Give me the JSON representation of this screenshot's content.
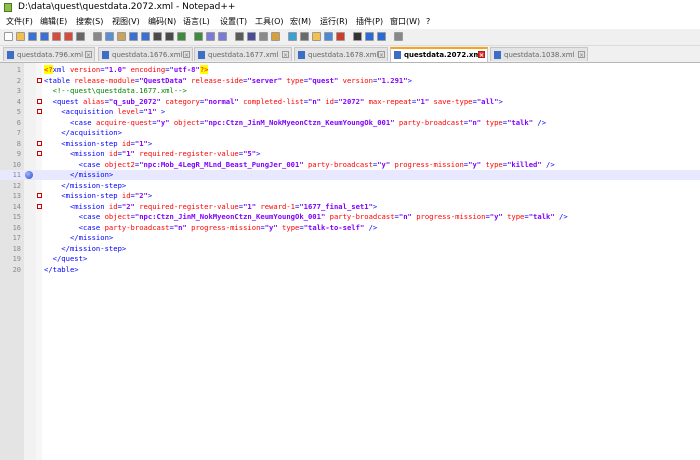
{
  "window": {
    "title": "D:\\data\\quest\\questdata.2072.xml - Notepad++"
  },
  "menu": [
    "文件(F)",
    "编辑(E)",
    "搜索(S)",
    "视图(V)",
    "编码(N)",
    "语言(L)",
    "设置(T)",
    "工具(O)",
    "宏(M)",
    "运行(R)",
    "插件(P)",
    "窗口(W)",
    "?"
  ],
  "tabs": [
    {
      "label": "questdata.796.xml",
      "active": false
    },
    {
      "label": "questdata.1676.xml",
      "active": false
    },
    {
      "label": "questdata.1677.xml",
      "active": false
    },
    {
      "label": "questdata.1678.xml",
      "active": false
    },
    {
      "label": "questdata.2072.xml",
      "active": true
    },
    {
      "label": "questdata.1038.xml",
      "active": false
    }
  ],
  "toolbar_icons": [
    "new-file-icon",
    "open-file-icon",
    "save-icon",
    "save-all-icon",
    "close-icon",
    "close-all-icon",
    "print-icon",
    "cut-icon",
    "copy-icon",
    "paste-icon",
    "undo-icon",
    "redo-icon",
    "find-icon",
    "replace-icon",
    "zoom-in-icon",
    "zoom-out-icon",
    "sync-v-icon",
    "sync-h-icon",
    "word-wrap-icon",
    "show-all-chars-icon",
    "indent-guide-icon",
    "lang-icon",
    "doc-map-icon",
    "func-list-icon",
    "folder-icon",
    "monitor-icon",
    "record-macro-icon",
    "stop-macro-icon",
    "play-macro-icon",
    "play-multi-icon",
    "save-macro-icon"
  ],
  "editor": {
    "current_line": 11,
    "bookmark_line": 11,
    "lines": [
      [
        [
          "decl",
          "<?"
        ],
        [
          "tag",
          "xml "
        ],
        [
          "attr",
          "version"
        ],
        [
          "tag",
          "="
        ],
        [
          "val",
          "\"1.0\""
        ],
        [
          "tag",
          " "
        ],
        [
          "attr",
          "encoding"
        ],
        [
          "tag",
          "="
        ],
        [
          "val",
          "\"utf-8\""
        ],
        [
          "decl",
          "?>"
        ]
      ],
      [
        [
          "tag",
          "<table "
        ],
        [
          "attr",
          "release-module"
        ],
        [
          "tag",
          "="
        ],
        [
          "val",
          "\"QuestData\""
        ],
        [
          "tag",
          " "
        ],
        [
          "attr",
          "release-side"
        ],
        [
          "tag",
          "="
        ],
        [
          "val",
          "\"server\""
        ],
        [
          "tag",
          " "
        ],
        [
          "attr",
          "type"
        ],
        [
          "tag",
          "="
        ],
        [
          "val",
          "\"quest\""
        ],
        [
          "tag",
          " "
        ],
        [
          "attr",
          "version"
        ],
        [
          "tag",
          "="
        ],
        [
          "val",
          "\"1.291\""
        ],
        [
          "tag",
          ">"
        ]
      ],
      [
        [
          "com",
          "  <!--quest\\questdata.1677.xml-->"
        ]
      ],
      [
        [
          "tag",
          "  <quest "
        ],
        [
          "attr",
          "alias"
        ],
        [
          "tag",
          "="
        ],
        [
          "val",
          "\"q_sub_2072\""
        ],
        [
          "tag",
          " "
        ],
        [
          "attr",
          "category"
        ],
        [
          "tag",
          "="
        ],
        [
          "val",
          "\"normal\""
        ],
        [
          "tag",
          " "
        ],
        [
          "attr",
          "completed-list"
        ],
        [
          "tag",
          "="
        ],
        [
          "val",
          "\"n\""
        ],
        [
          "tag",
          " "
        ],
        [
          "attr",
          "id"
        ],
        [
          "tag",
          "="
        ],
        [
          "val",
          "\"2072\""
        ],
        [
          "tag",
          " "
        ],
        [
          "attr",
          "max-repeat"
        ],
        [
          "tag",
          "="
        ],
        [
          "val",
          "\"1\""
        ],
        [
          "tag",
          " "
        ],
        [
          "attr",
          "save-type"
        ],
        [
          "tag",
          "="
        ],
        [
          "val",
          "\"all\""
        ],
        [
          "tag",
          ">"
        ]
      ],
      [
        [
          "tag",
          "    <acquisition "
        ],
        [
          "attr",
          "level"
        ],
        [
          "tag",
          "="
        ],
        [
          "val",
          "\"1\""
        ],
        [
          "tag",
          " >"
        ]
      ],
      [
        [
          "tag",
          "      <case "
        ],
        [
          "attr",
          "acquire-quest"
        ],
        [
          "tag",
          "="
        ],
        [
          "val",
          "\"y\""
        ],
        [
          "tag",
          " "
        ],
        [
          "attr",
          "object"
        ],
        [
          "tag",
          "="
        ],
        [
          "val",
          "\"npc:Ctzn_JinM_NokMyeonCtzn_KeumYoungOk_001\""
        ],
        [
          "tag",
          " "
        ],
        [
          "attr",
          "party-broadcast"
        ],
        [
          "tag",
          "="
        ],
        [
          "val",
          "\"n\""
        ],
        [
          "tag",
          " "
        ],
        [
          "attr",
          "type"
        ],
        [
          "tag",
          "="
        ],
        [
          "val",
          "\"talk\""
        ],
        [
          "tag",
          " />"
        ]
      ],
      [
        [
          "tag",
          "    </acquisition>"
        ]
      ],
      [
        [
          "tag",
          "    <mission-step "
        ],
        [
          "attr",
          "id"
        ],
        [
          "tag",
          "="
        ],
        [
          "val",
          "\"1\""
        ],
        [
          "tag",
          ">"
        ]
      ],
      [
        [
          "tag",
          "      <mission "
        ],
        [
          "attr",
          "id"
        ],
        [
          "tag",
          "="
        ],
        [
          "val",
          "\"1\""
        ],
        [
          "tag",
          " "
        ],
        [
          "attr",
          "required-register-value"
        ],
        [
          "tag",
          "="
        ],
        [
          "val",
          "\"5\""
        ],
        [
          "tag",
          ">"
        ]
      ],
      [
        [
          "tag",
          "        <case "
        ],
        [
          "attr",
          "object2"
        ],
        [
          "tag",
          "="
        ],
        [
          "val",
          "\"npc:Mob_4LegR_MLnd_Beast_PungJer_001\""
        ],
        [
          "tag",
          " "
        ],
        [
          "attr",
          "party-broadcast"
        ],
        [
          "tag",
          "="
        ],
        [
          "val",
          "\"y\""
        ],
        [
          "tag",
          " "
        ],
        [
          "attr",
          "progress-mission"
        ],
        [
          "tag",
          "="
        ],
        [
          "val",
          "\"y\""
        ],
        [
          "tag",
          " "
        ],
        [
          "attr",
          "type"
        ],
        [
          "tag",
          "="
        ],
        [
          "val",
          "\"killed\""
        ],
        [
          "tag",
          " />"
        ]
      ],
      [
        [
          "tag",
          "      </mission>"
        ]
      ],
      [
        [
          "tag",
          "    </mission-step>"
        ]
      ],
      [
        [
          "tag",
          "    <mission-step "
        ],
        [
          "attr",
          "id"
        ],
        [
          "tag",
          "="
        ],
        [
          "val",
          "\"2\""
        ],
        [
          "tag",
          ">"
        ]
      ],
      [
        [
          "tag",
          "      <mission "
        ],
        [
          "attr",
          "id"
        ],
        [
          "tag",
          "="
        ],
        [
          "val",
          "\"2\""
        ],
        [
          "tag",
          " "
        ],
        [
          "attr",
          "required-register-value"
        ],
        [
          "tag",
          "="
        ],
        [
          "val",
          "\"1\""
        ],
        [
          "tag",
          " "
        ],
        [
          "attr",
          "reward-1"
        ],
        [
          "tag",
          "="
        ],
        [
          "val",
          "\"1677_final_set1\""
        ],
        [
          "tag",
          ">"
        ]
      ],
      [
        [
          "tag",
          "        <case "
        ],
        [
          "attr",
          "object"
        ],
        [
          "tag",
          "="
        ],
        [
          "val",
          "\"npc:Ctzn_JinM_NokMyeonCtzn_KeumYoungOk_001\""
        ],
        [
          "tag",
          " "
        ],
        [
          "attr",
          "party-broadcast"
        ],
        [
          "tag",
          "="
        ],
        [
          "val",
          "\"n\""
        ],
        [
          "tag",
          " "
        ],
        [
          "attr",
          "progress-mission"
        ],
        [
          "tag",
          "="
        ],
        [
          "val",
          "\"y\""
        ],
        [
          "tag",
          " "
        ],
        [
          "attr",
          "type"
        ],
        [
          "tag",
          "="
        ],
        [
          "val",
          "\"talk\""
        ],
        [
          "tag",
          " />"
        ]
      ],
      [
        [
          "tag",
          "        <case "
        ],
        [
          "attr",
          "party-broadcast"
        ],
        [
          "tag",
          "="
        ],
        [
          "val",
          "\"n\""
        ],
        [
          "tag",
          " "
        ],
        [
          "attr",
          "progress-mission"
        ],
        [
          "tag",
          "="
        ],
        [
          "val",
          "\"y\""
        ],
        [
          "tag",
          " "
        ],
        [
          "attr",
          "type"
        ],
        [
          "tag",
          "="
        ],
        [
          "val",
          "\"talk-to-self\""
        ],
        [
          "tag",
          " />"
        ]
      ],
      [
        [
          "tag",
          "      </mission>"
        ]
      ],
      [
        [
          "tag",
          "    </mission-step>"
        ]
      ],
      [
        [
          "tag",
          "  </quest>"
        ]
      ],
      [
        [
          "tag",
          "</table>"
        ]
      ]
    ]
  },
  "colors": {
    "tag": "#0000ff",
    "attr": "#ff0000",
    "val": "#8000ff",
    "comment": "#008000",
    "active_tab_accent": "#f7a31c",
    "current_line": "#e8e8ff"
  }
}
